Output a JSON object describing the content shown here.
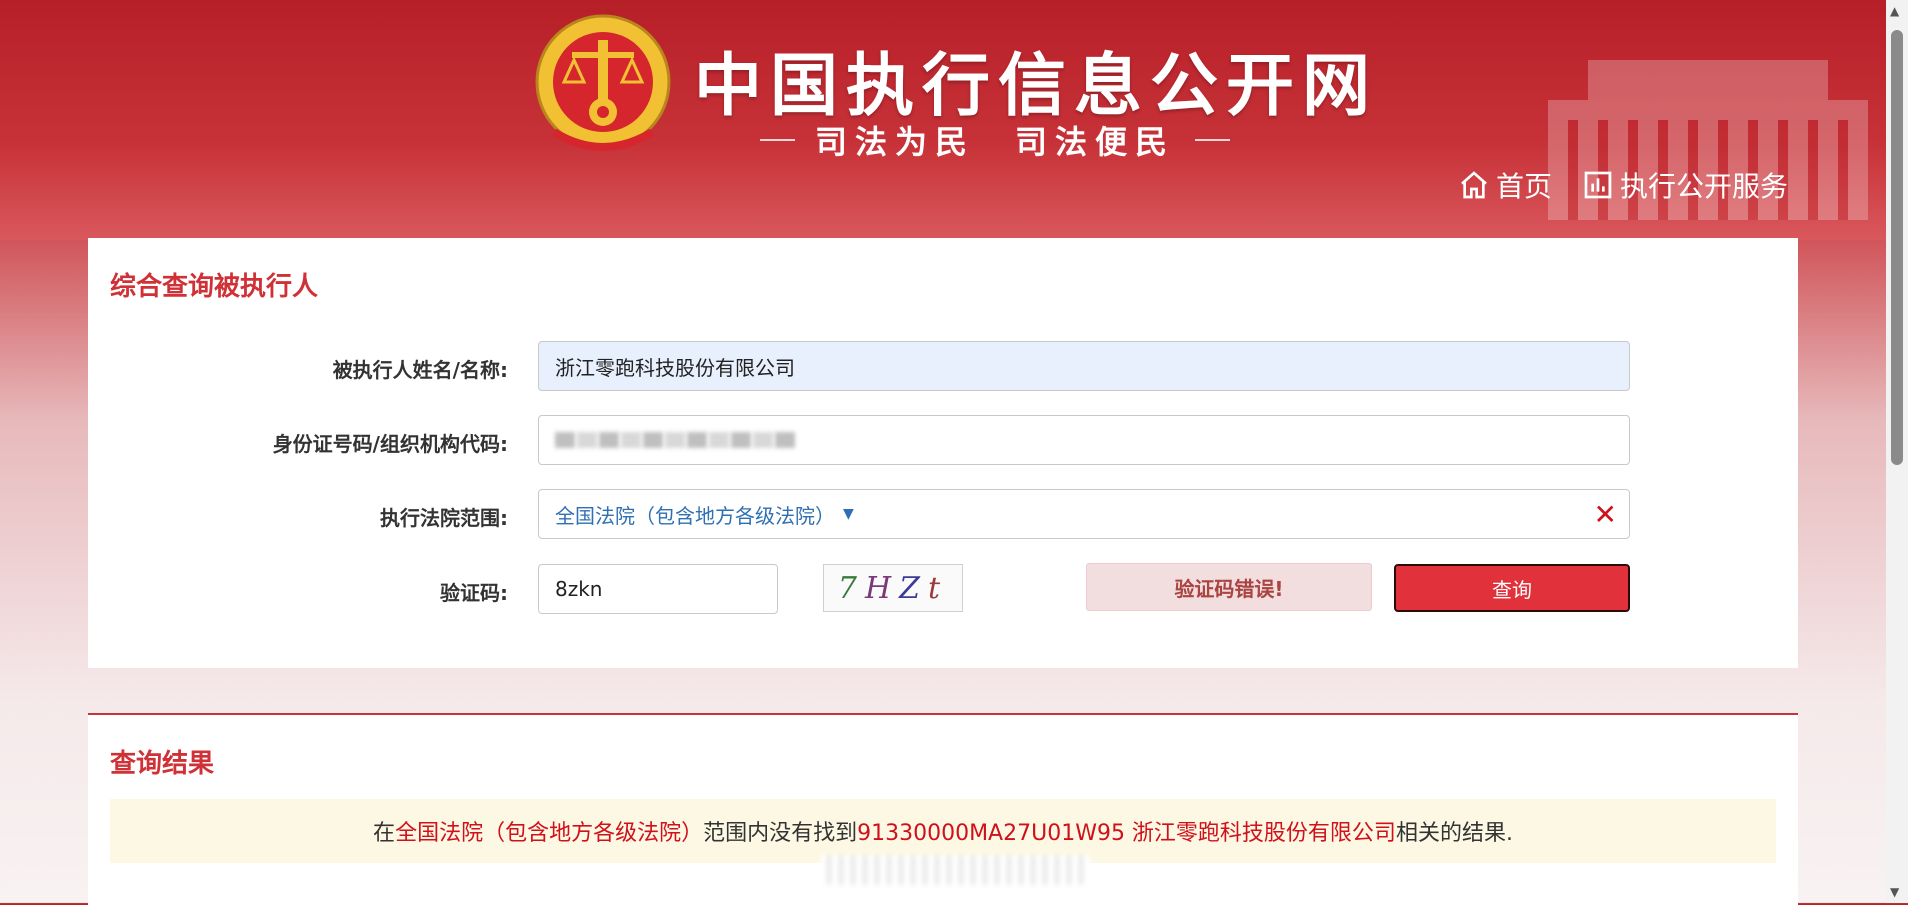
{
  "header": {
    "site_title": "中国执行信息公开网",
    "slogan": "司法为民　司法便民",
    "nav": [
      {
        "label": "首页",
        "icon": "home-icon"
      },
      {
        "label": "执行公开服务",
        "icon": "bar-chart-icon"
      }
    ]
  },
  "query": {
    "title": "综合查询被执行人",
    "name_label": "被执行人姓名/名称:",
    "name_value": "浙江零跑科技股份有限公司",
    "id_label": "身份证号码/组织机构代码:",
    "court_label": "执行法院范围:",
    "court_value": "全国法院（包含地方各级法院）",
    "captcha_label": "验证码:",
    "captcha_value": "8zkn",
    "captcha_image_text": [
      "7",
      "H",
      "Z",
      "t"
    ],
    "error_message": "验证码错误!",
    "search_button": "查询"
  },
  "result": {
    "title": "查询结果",
    "prefix": "在",
    "court": "全国法院（包含地方各级法院）",
    "middle": "范围内没有找到",
    "code_name": "91330000MA27U01W95 浙江零跑科技股份有限公司",
    "suffix": "相关的结果."
  },
  "colors": {
    "header_red": "#b71f28",
    "accent_red": "#d03136",
    "button_red": "#e1313b",
    "error_bg": "#f2dede",
    "result_bg": "#fcf8e3"
  }
}
